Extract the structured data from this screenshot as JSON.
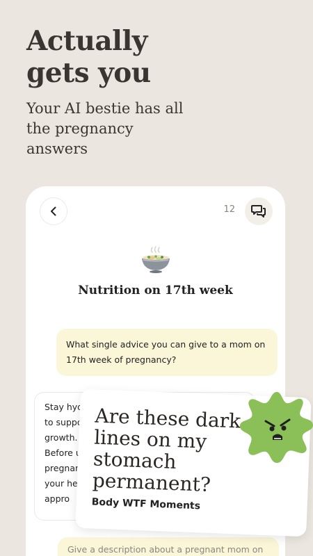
{
  "hero": {
    "title": "Actually\ngets you",
    "subtitle": "Your AI bestie has all\nthe pregnancy\nanswers"
  },
  "chat": {
    "count": "12",
    "topic_title": "Nutrition on 17th week",
    "user_message": "What single advice you can give to a mom on 17th week of pregnancy?",
    "ai_message_visible": "Stay hyd\nto suppo\ngrowth.\nBefore u\npregnan\nyour he\nappro",
    "suggestion": "Give a description about a pregnant mom on"
  },
  "card": {
    "question": "Are these dark\nlines on my\nstomach\npermanent?",
    "category": "Body WTF Moments"
  },
  "colors": {
    "background": "#ebe7e0",
    "bubble_yellow": "#fbf6d8",
    "blob_green": "#8bbf57"
  },
  "icons": {
    "back": "chevron-left-icon",
    "chat": "chat-bubbles-icon",
    "topic": "food-bowl-icon",
    "mascot": "angry-green-blob-icon"
  }
}
